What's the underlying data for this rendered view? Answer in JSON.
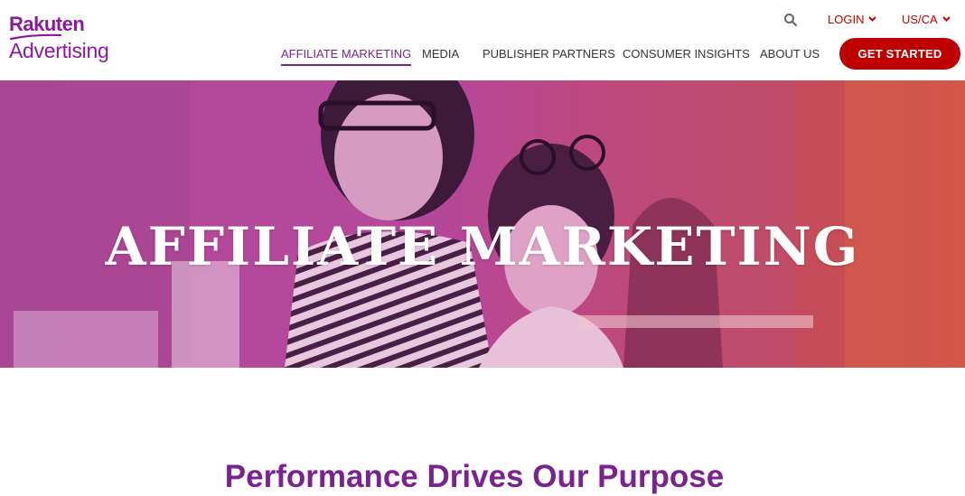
{
  "brand": {
    "line1": "Rakuten",
    "line2": "Advertising",
    "color": "#8a1a9b"
  },
  "utility": {
    "search_icon": "search-icon",
    "login_label": "LOGIN",
    "region_label": "US/CA"
  },
  "nav": {
    "items": [
      {
        "label": "AFFILIATE MARKETING",
        "active": true
      },
      {
        "label": "MEDIA",
        "active": false
      },
      {
        "label": "PUBLISHER PARTNERS",
        "active": false
      },
      {
        "label": "CONSUMER INSIGHTS",
        "active": false
      },
      {
        "label": "ABOUT US",
        "active": false
      }
    ],
    "cta_label": "GET STARTED"
  },
  "hero": {
    "title": "AFFILIATE MARKETING"
  },
  "section": {
    "title": "Performance Drives Our Purpose"
  },
  "colors": {
    "accent_purple": "#7a2290",
    "brand_red": "#bf0000"
  }
}
